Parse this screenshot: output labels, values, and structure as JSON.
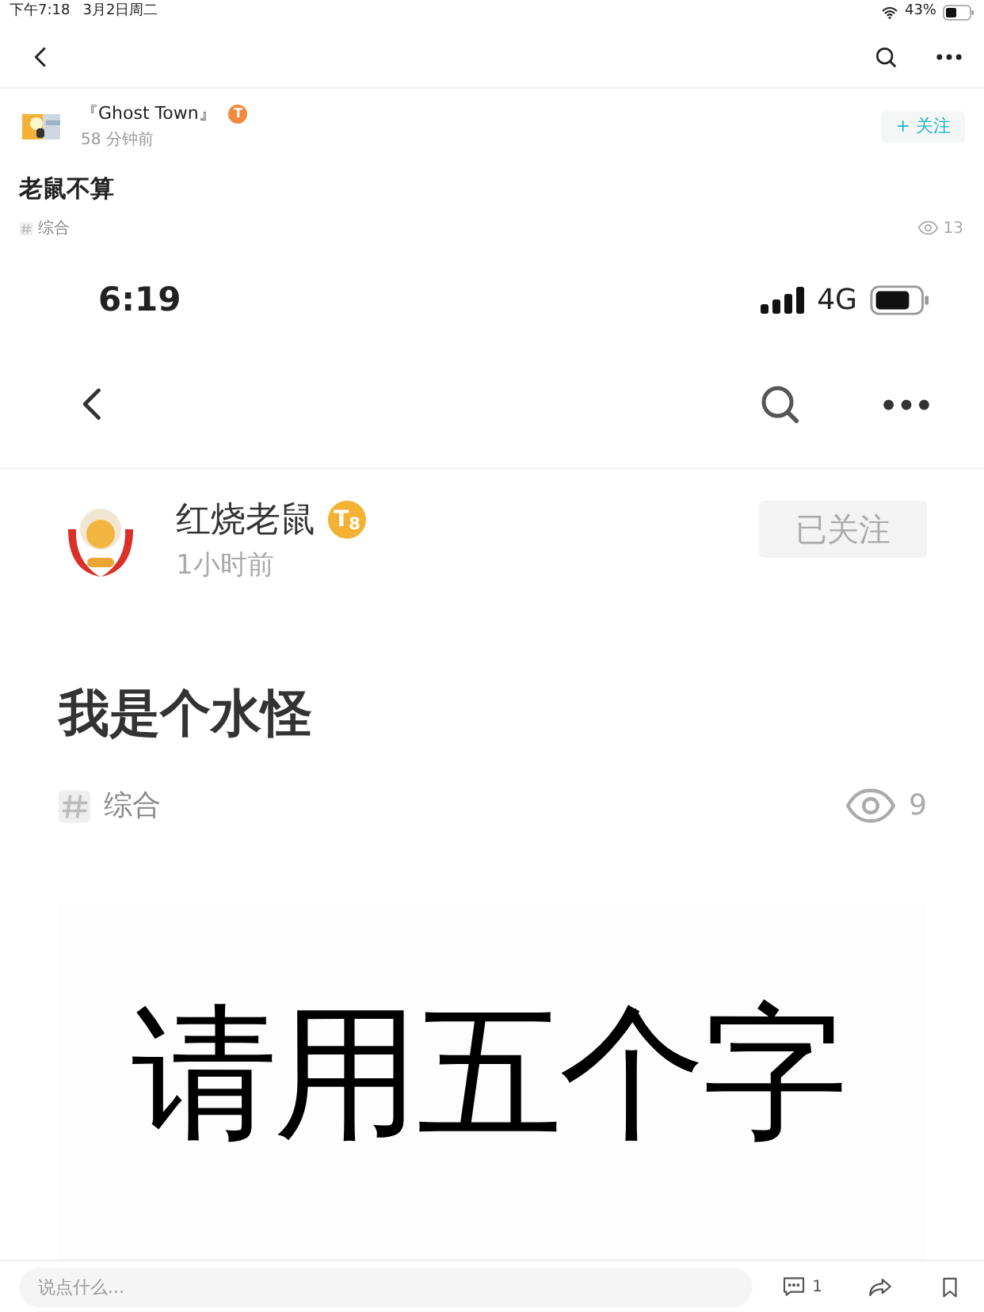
{
  "status_bar": {
    "time": "下午7:18",
    "date": "3月2日周二",
    "battery": "43%"
  },
  "post": {
    "author": "『Ghost Town』",
    "badge": "T",
    "time": "58 分钟前",
    "follow": {
      "label": "+ 关注",
      "followed": false
    },
    "title": "老鼠不算",
    "tag": "综合",
    "views": "13",
    "embedded_screenshot": {
      "status_time": "6:19",
      "network": "4G",
      "author": "红烧老鼠",
      "badge": "T$_{8}$",
      "time": "1小时前",
      "follow": {
        "label": "已关注",
        "followed": true
      },
      "title": "我是个水怪",
      "tag": "综合",
      "views": "9",
      "image_text": "请用五个字"
    }
  },
  "comment_bar": {
    "placeholder": "说点什么...",
    "comments": "1"
  }
}
